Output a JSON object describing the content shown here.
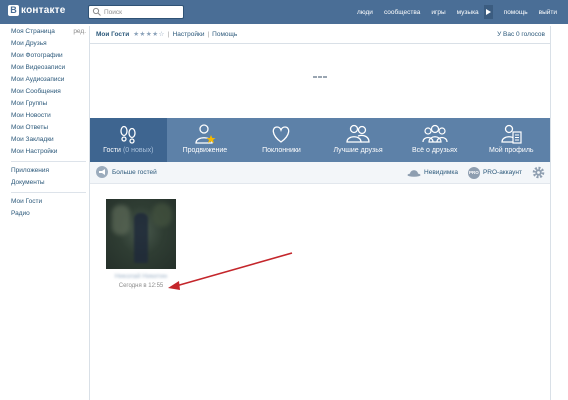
{
  "header": {
    "logo_letter": "В",
    "logo_text": "контакте",
    "search_placeholder": "Поиск",
    "nav": [
      "люди",
      "сообщества",
      "игры",
      "музыка",
      "помощь",
      "выйти"
    ]
  },
  "sidebar": {
    "edit_label": "ред.",
    "items": [
      "Моя Страница",
      "Мои Друзья",
      "Мои Фотографии",
      "Мои Видеозаписи",
      "Мои Аудиозаписи",
      "Мои Сообщения",
      "Мои Группы",
      "Мои Новости",
      "Мои Ответы",
      "Мои Закладки",
      "Мои Настройки"
    ],
    "items2": [
      "Приложения",
      "Документы"
    ],
    "items3": [
      "Мои Гости",
      "Радио"
    ]
  },
  "breadcrumb": {
    "title": "Мои Гости",
    "stars": "★★★★☆",
    "settings": "Настройки",
    "help": "Помощь",
    "separator": "|",
    "right_text": "У Вас 0 голосов"
  },
  "tabs": [
    {
      "label": "Гости",
      "count": "(0 новых)",
      "icon": "footprints-icon",
      "active": true
    },
    {
      "label": "Продвижение",
      "icon": "promotion-person-star-icon"
    },
    {
      "label": "Поклонники",
      "icon": "heart-icon"
    },
    {
      "label": "Лучшие друзья",
      "icon": "best-friends-icon"
    },
    {
      "label": "Всё о друзьях",
      "icon": "group-icon"
    },
    {
      "label": "Мой профиль",
      "icon": "profile-icon"
    }
  ],
  "toolbar": {
    "more_guests": "Больше гостей",
    "invisible": "Невидимка",
    "pro_badge": "PRO",
    "pro_account": "PRO-аккаунт"
  },
  "guest": {
    "name": "Николай Никитин",
    "time": "Сегодня в 12:55"
  },
  "colors": {
    "header_bg": "#4a6e96",
    "tab_bar_bg": "#5d81a8",
    "tab_active_bg": "#3e6590",
    "link": "#2b587a",
    "arrow": "#c4262b"
  }
}
